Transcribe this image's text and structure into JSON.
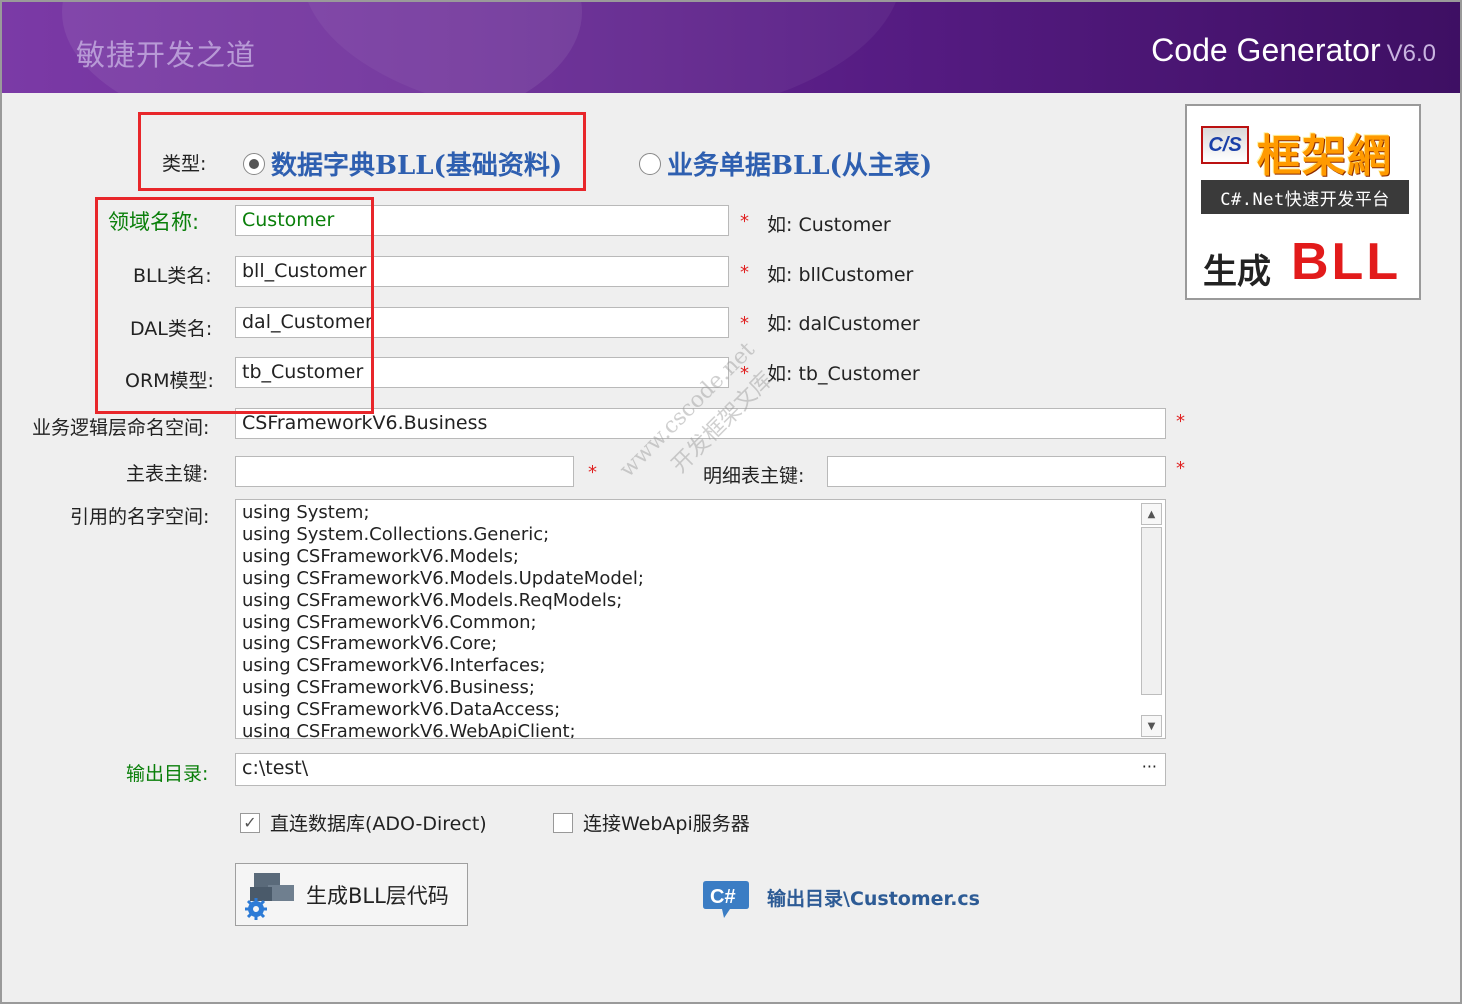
{
  "header": {
    "app_title": "敏捷开发之道",
    "brand": "Code Generator",
    "version": "V6.0"
  },
  "type_row": {
    "label": "类型:",
    "options": [
      {
        "label": "数据字典BLL(基础资料)",
        "selected": true
      },
      {
        "label": "业务单据BLL(从主表)",
        "selected": false
      }
    ]
  },
  "fields": {
    "domain": {
      "label": "领域名称:",
      "value": "Customer",
      "hint": "如: Customer"
    },
    "bll_class": {
      "label": "BLL类名:",
      "value": "bll_Customer",
      "hint": "如: bllCustomer"
    },
    "dal_class": {
      "label": "DAL类名:",
      "value": "dal_Customer",
      "hint": "如: dalCustomer"
    },
    "orm_model": {
      "label": "ORM模型:",
      "value": "tb_Customer",
      "hint": "如: tb_Customer"
    },
    "namespace": {
      "label": "业务逻辑层命名空间:",
      "value": "CSFrameworkV6.Business"
    },
    "master_key": {
      "label": "主表主键:",
      "value": ""
    },
    "detail_key": {
      "label": "明细表主键:",
      "value": ""
    }
  },
  "required_mark": "*",
  "usings": {
    "label": "引用的名字空间:",
    "lines": [
      "using System;",
      "using System.Collections.Generic;",
      "using CSFrameworkV6.Models;",
      "using CSFrameworkV6.Models.UpdateModel;",
      "using CSFrameworkV6.Models.ReqModels;",
      "using CSFrameworkV6.Common;",
      "using CSFrameworkV6.Core;",
      "using CSFrameworkV6.Interfaces;",
      "using CSFrameworkV6.Business;",
      "using CSFrameworkV6.DataAccess;",
      "using CSFrameworkV6.WebApiClient;"
    ]
  },
  "output": {
    "label": "输出目录:",
    "value": "c:\\test\\",
    "browse": "···"
  },
  "checkboxes": [
    {
      "label": "直连数据库(ADO-Direct)",
      "checked": true
    },
    {
      "label": "连接WebApi服务器",
      "checked": false
    }
  ],
  "generate_button": "生成BLL层代码",
  "output_link": "输出目录\\Customer.cs",
  "logo": {
    "cs": "C/S",
    "name": "框架網",
    "tagline": "C#.Net快速开发平台",
    "generate": "生成",
    "bll": "BLL"
  },
  "watermark": {
    "line1": "www.cscode.net",
    "line2": "开发框架文库"
  },
  "colors": {
    "header_start": "#7b3aa6",
    "header_end": "#3e0f63",
    "required": "#e02020",
    "highlight_box": "#e8262a",
    "label_green": "#0a7f0a",
    "link": "#2d5b95"
  }
}
